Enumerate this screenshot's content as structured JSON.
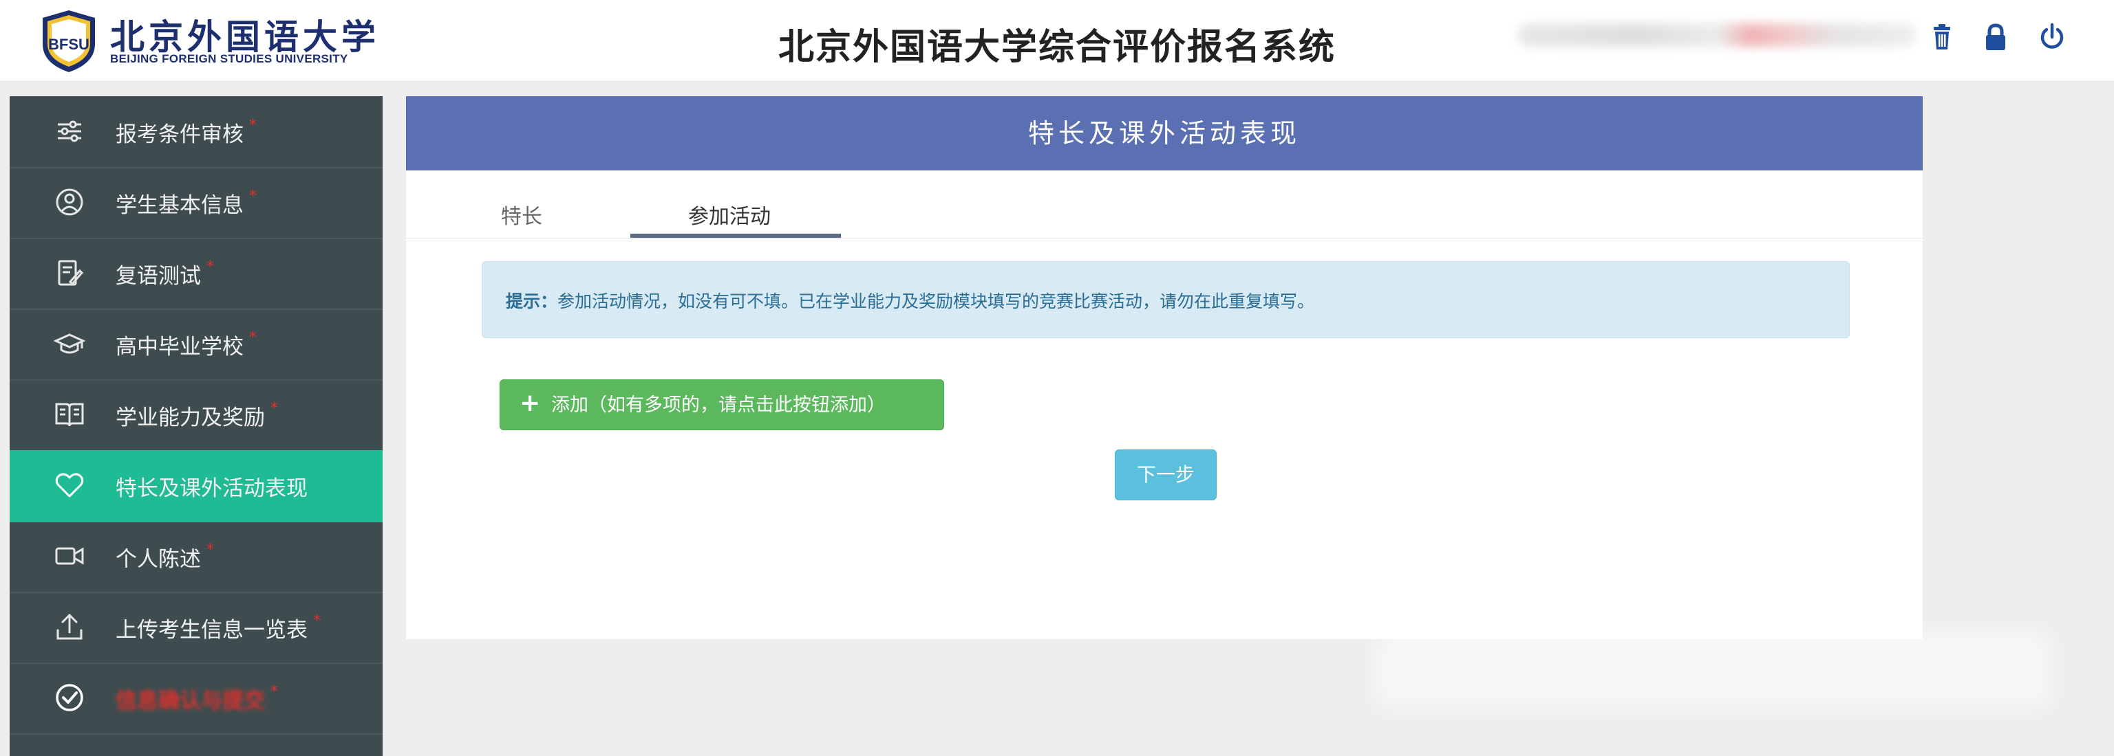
{
  "colors": {
    "header_bg": "#ffffff",
    "sidebar_bg": "#3f4c4f",
    "sidebar_active": "#1fbb95",
    "panel_header": "#5b6fb3",
    "alert_bg": "#d8eaf4",
    "add_button": "#5cb85c",
    "next_button": "#5bc0de",
    "required_mark": "#e0302a"
  },
  "header": {
    "logo_cn": "北京外国语大学",
    "logo_en": "BEIJING FOREIGN STUDIES UNIVERSITY",
    "system_title": "北京外国语大学综合评价报名系统",
    "icons": [
      "trash-icon",
      "lock-icon",
      "power-icon"
    ]
  },
  "sidebar": {
    "items": [
      {
        "label": "报考条件审核",
        "icon": "sliders-icon",
        "required": "*"
      },
      {
        "label": "学生基本信息",
        "icon": "user-circle-icon",
        "required": "*"
      },
      {
        "label": "复语测试",
        "icon": "edit-document-icon",
        "required": "*"
      },
      {
        "label": "高中毕业学校",
        "icon": "graduation-cap-icon",
        "required": "*"
      },
      {
        "label": "学业能力及奖励",
        "icon": "book-icon",
        "required": "*"
      },
      {
        "label": "特长及课外活动表现",
        "icon": "heart-icon",
        "required": "",
        "active": true
      },
      {
        "label": "个人陈述",
        "icon": "video-camera-icon",
        "required": "*"
      },
      {
        "label": "上传考生信息一览表",
        "icon": "upload-icon",
        "required": "*"
      },
      {
        "label": "信息确认与提交",
        "icon": "check-circle-icon",
        "required": "*",
        "obscured": true
      }
    ]
  },
  "main": {
    "panel_title": "特长及课外活动表现",
    "tabs": [
      {
        "label": "特长",
        "active": false
      },
      {
        "label": "参加活动",
        "active": true
      }
    ],
    "alert": {
      "prefix": "提示：",
      "text": "参加活动情况，如没有可不填。已在学业能力及奖励模块填写的竞赛比赛活动，请勿在此重复填写。"
    },
    "add_button": {
      "icon": "plus-icon",
      "label": "添加（如有多项的，请点击此按钮添加）"
    },
    "next_button": "下一步"
  }
}
